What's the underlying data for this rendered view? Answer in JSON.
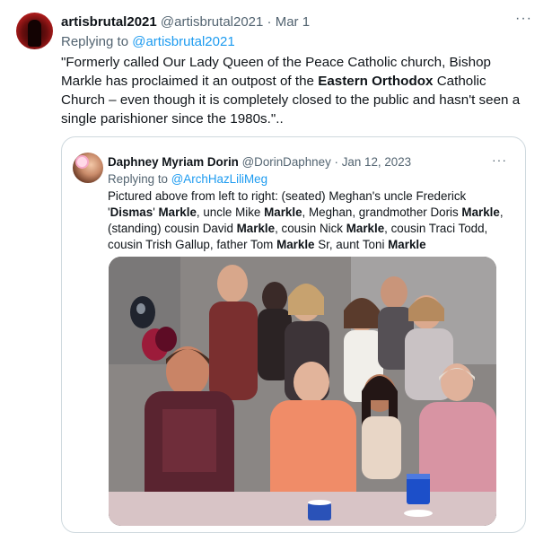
{
  "tweet": {
    "display_name": "artisbrutal2021",
    "handle": "@artisbrutal2021",
    "separator": " · ",
    "date": "Mar 1",
    "replying_prefix": "Replying to ",
    "replying_to": "@artisbrutal2021",
    "text_part1": "\"Formerly called Our Lady Queen of the Peace Catholic church, Bishop Markle has proclaimed it an outpost of the ",
    "text_bold": "Eastern Orthodox",
    "text_part2": " Catholic Church – even though it is completely closed to the public and hasn't seen a single parishioner since the 1980s.\".."
  },
  "quoted": {
    "display_name": "Daphney Myriam Dorin",
    "handle": "@DorinDaphney",
    "separator": " · ",
    "date": "Jan 12, 2023",
    "replying_prefix": "Replying to ",
    "replying_to": "@ArchHazLiliMeg",
    "segments": [
      {
        "t": "Pictured above from left to right: (seated) Meghan's uncle Frederick '",
        "b": false
      },
      {
        "t": "Dismas",
        "b": true
      },
      {
        "t": "' ",
        "b": false
      },
      {
        "t": "Markle",
        "b": true
      },
      {
        "t": ", uncle Mike ",
        "b": false
      },
      {
        "t": "Markle",
        "b": true
      },
      {
        "t": ", Meghan, grandmother Doris ",
        "b": false
      },
      {
        "t": "Markle",
        "b": true
      },
      {
        "t": ", (standing) cousin David ",
        "b": false
      },
      {
        "t": "Markle",
        "b": true
      },
      {
        "t": ", cousin Nick ",
        "b": false
      },
      {
        "t": "Markle",
        "b": true
      },
      {
        "t": ", cousin Traci Todd, cousin Trish Gallup, father Tom ",
        "b": false
      },
      {
        "t": "Markle",
        "b": true
      },
      {
        "t": " Sr, aunt Toni ",
        "b": false
      },
      {
        "t": "Markle",
        "b": true
      }
    ]
  },
  "icons": {
    "more": "more-horizontal-icon",
    "photo": "group-family-photo"
  },
  "more_glyph": "···",
  "colors": {
    "link": "#1d9bf0",
    "secondary": "#536471",
    "border": "#cfd9de"
  }
}
